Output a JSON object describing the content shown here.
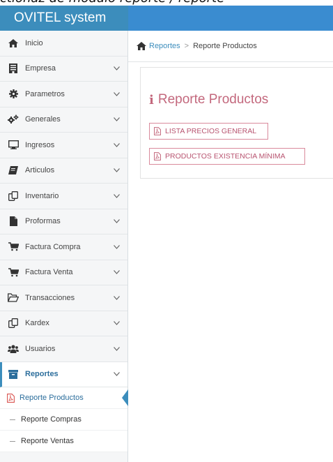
{
  "caption": "ctionaz de modulo reporte / reporte",
  "brand": "OVITEL system",
  "sidebar": {
    "items": [
      {
        "label": "Inicio",
        "icon": "home-icon",
        "chevron": false
      },
      {
        "label": "Empresa",
        "icon": "building-icon",
        "chevron": true
      },
      {
        "label": "Parametros",
        "icon": "gear-icon",
        "chevron": true
      },
      {
        "label": "Generales",
        "icon": "gears-icon",
        "chevron": true
      },
      {
        "label": "Ingresos",
        "icon": "monitor-icon",
        "chevron": true
      },
      {
        "label": "Articulos",
        "icon": "book-icon",
        "chevron": true
      },
      {
        "label": "Inventario",
        "icon": "copy-icon",
        "chevron": true
      },
      {
        "label": "Proformas",
        "icon": "file-icon",
        "chevron": true
      },
      {
        "label": "Factura Compra",
        "icon": "cart-icon",
        "chevron": true
      },
      {
        "label": "Factura Venta",
        "icon": "cart-icon",
        "chevron": true
      },
      {
        "label": "Transacciones",
        "icon": "folder-open-icon",
        "chevron": true
      },
      {
        "label": "Kardex",
        "icon": "copy-icon",
        "chevron": true
      },
      {
        "label": "Usuarios",
        "icon": "users-icon",
        "chevron": true
      },
      {
        "label": "Reportes",
        "icon": "archive-icon",
        "chevron": true
      }
    ],
    "sub_items": [
      {
        "label": "Reporte Productos",
        "icon": "pdf-icon"
      },
      {
        "label": "Reporte Compras"
      },
      {
        "label": "Reporte Ventas"
      }
    ]
  },
  "breadcrumb": {
    "link": "Reportes",
    "separator": ">",
    "current": "Reporte Productos"
  },
  "content": {
    "title": "Reporte Productos",
    "buttons": [
      {
        "label": "LISTA PRECIOS GENERAL"
      },
      {
        "label": "PRODUCTOS EXISTENCIA MÍNIMA"
      }
    ]
  },
  "colors": {
    "header": "#3c8dbc",
    "accent_pink": "#c3687d",
    "link_blue": "#3c8dbc"
  }
}
